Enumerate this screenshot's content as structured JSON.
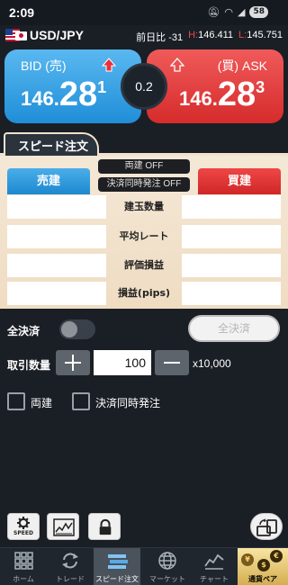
{
  "status_bar": {
    "time": "2:09",
    "battery": "58"
  },
  "pair": {
    "name": "USD/JPY",
    "change_label": "前日比",
    "change_value": "-31",
    "high_label": "H:",
    "high_value": "146.411",
    "low_label": "L:",
    "low_value": "145.751"
  },
  "bid": {
    "label": "BID (売)",
    "price_prefix": "146.",
    "price_pips": "28",
    "price_fraction": "1"
  },
  "ask": {
    "label": "(買) ASK",
    "price_prefix": "146.",
    "price_pips": "28",
    "price_fraction": "3"
  },
  "spread": "0.2",
  "speed_tab": {
    "label": "スピード注文"
  },
  "order_panel": {
    "toggle_hedge": "両建 OFF",
    "toggle_simul": "決済同時発注 OFF",
    "sell_label": "売建",
    "buy_label": "買建",
    "rows": [
      {
        "label": "建玉数量"
      },
      {
        "label": "平均レート"
      },
      {
        "label": "評価損益"
      },
      {
        "label": "損益(pips)"
      }
    ]
  },
  "settlement": {
    "label": "全決済",
    "button_label": "全決済"
  },
  "quantity": {
    "label": "取引数量",
    "value": "100",
    "unit": "x10,000"
  },
  "checkboxes": {
    "hedge_label": "両建",
    "simul_label": "決済同時発注"
  },
  "tools": {
    "speed_label": "SPEED"
  },
  "bottom_nav": [
    {
      "label": "ホーム",
      "icon": "grid-icon"
    },
    {
      "label": "トレード",
      "icon": "refresh-icon"
    },
    {
      "label": "スピード注文",
      "icon": "speed-icon"
    },
    {
      "label": "マーケット",
      "icon": "globe-icon"
    },
    {
      "label": "チャート",
      "icon": "chart-icon"
    },
    {
      "label": "通貨ペア",
      "icon": "currency-icon"
    }
  ],
  "colors": {
    "bid": "#1f8ed8",
    "ask": "#d62b2b",
    "panel": "#f4e8d6",
    "background": "#1a1f26"
  }
}
